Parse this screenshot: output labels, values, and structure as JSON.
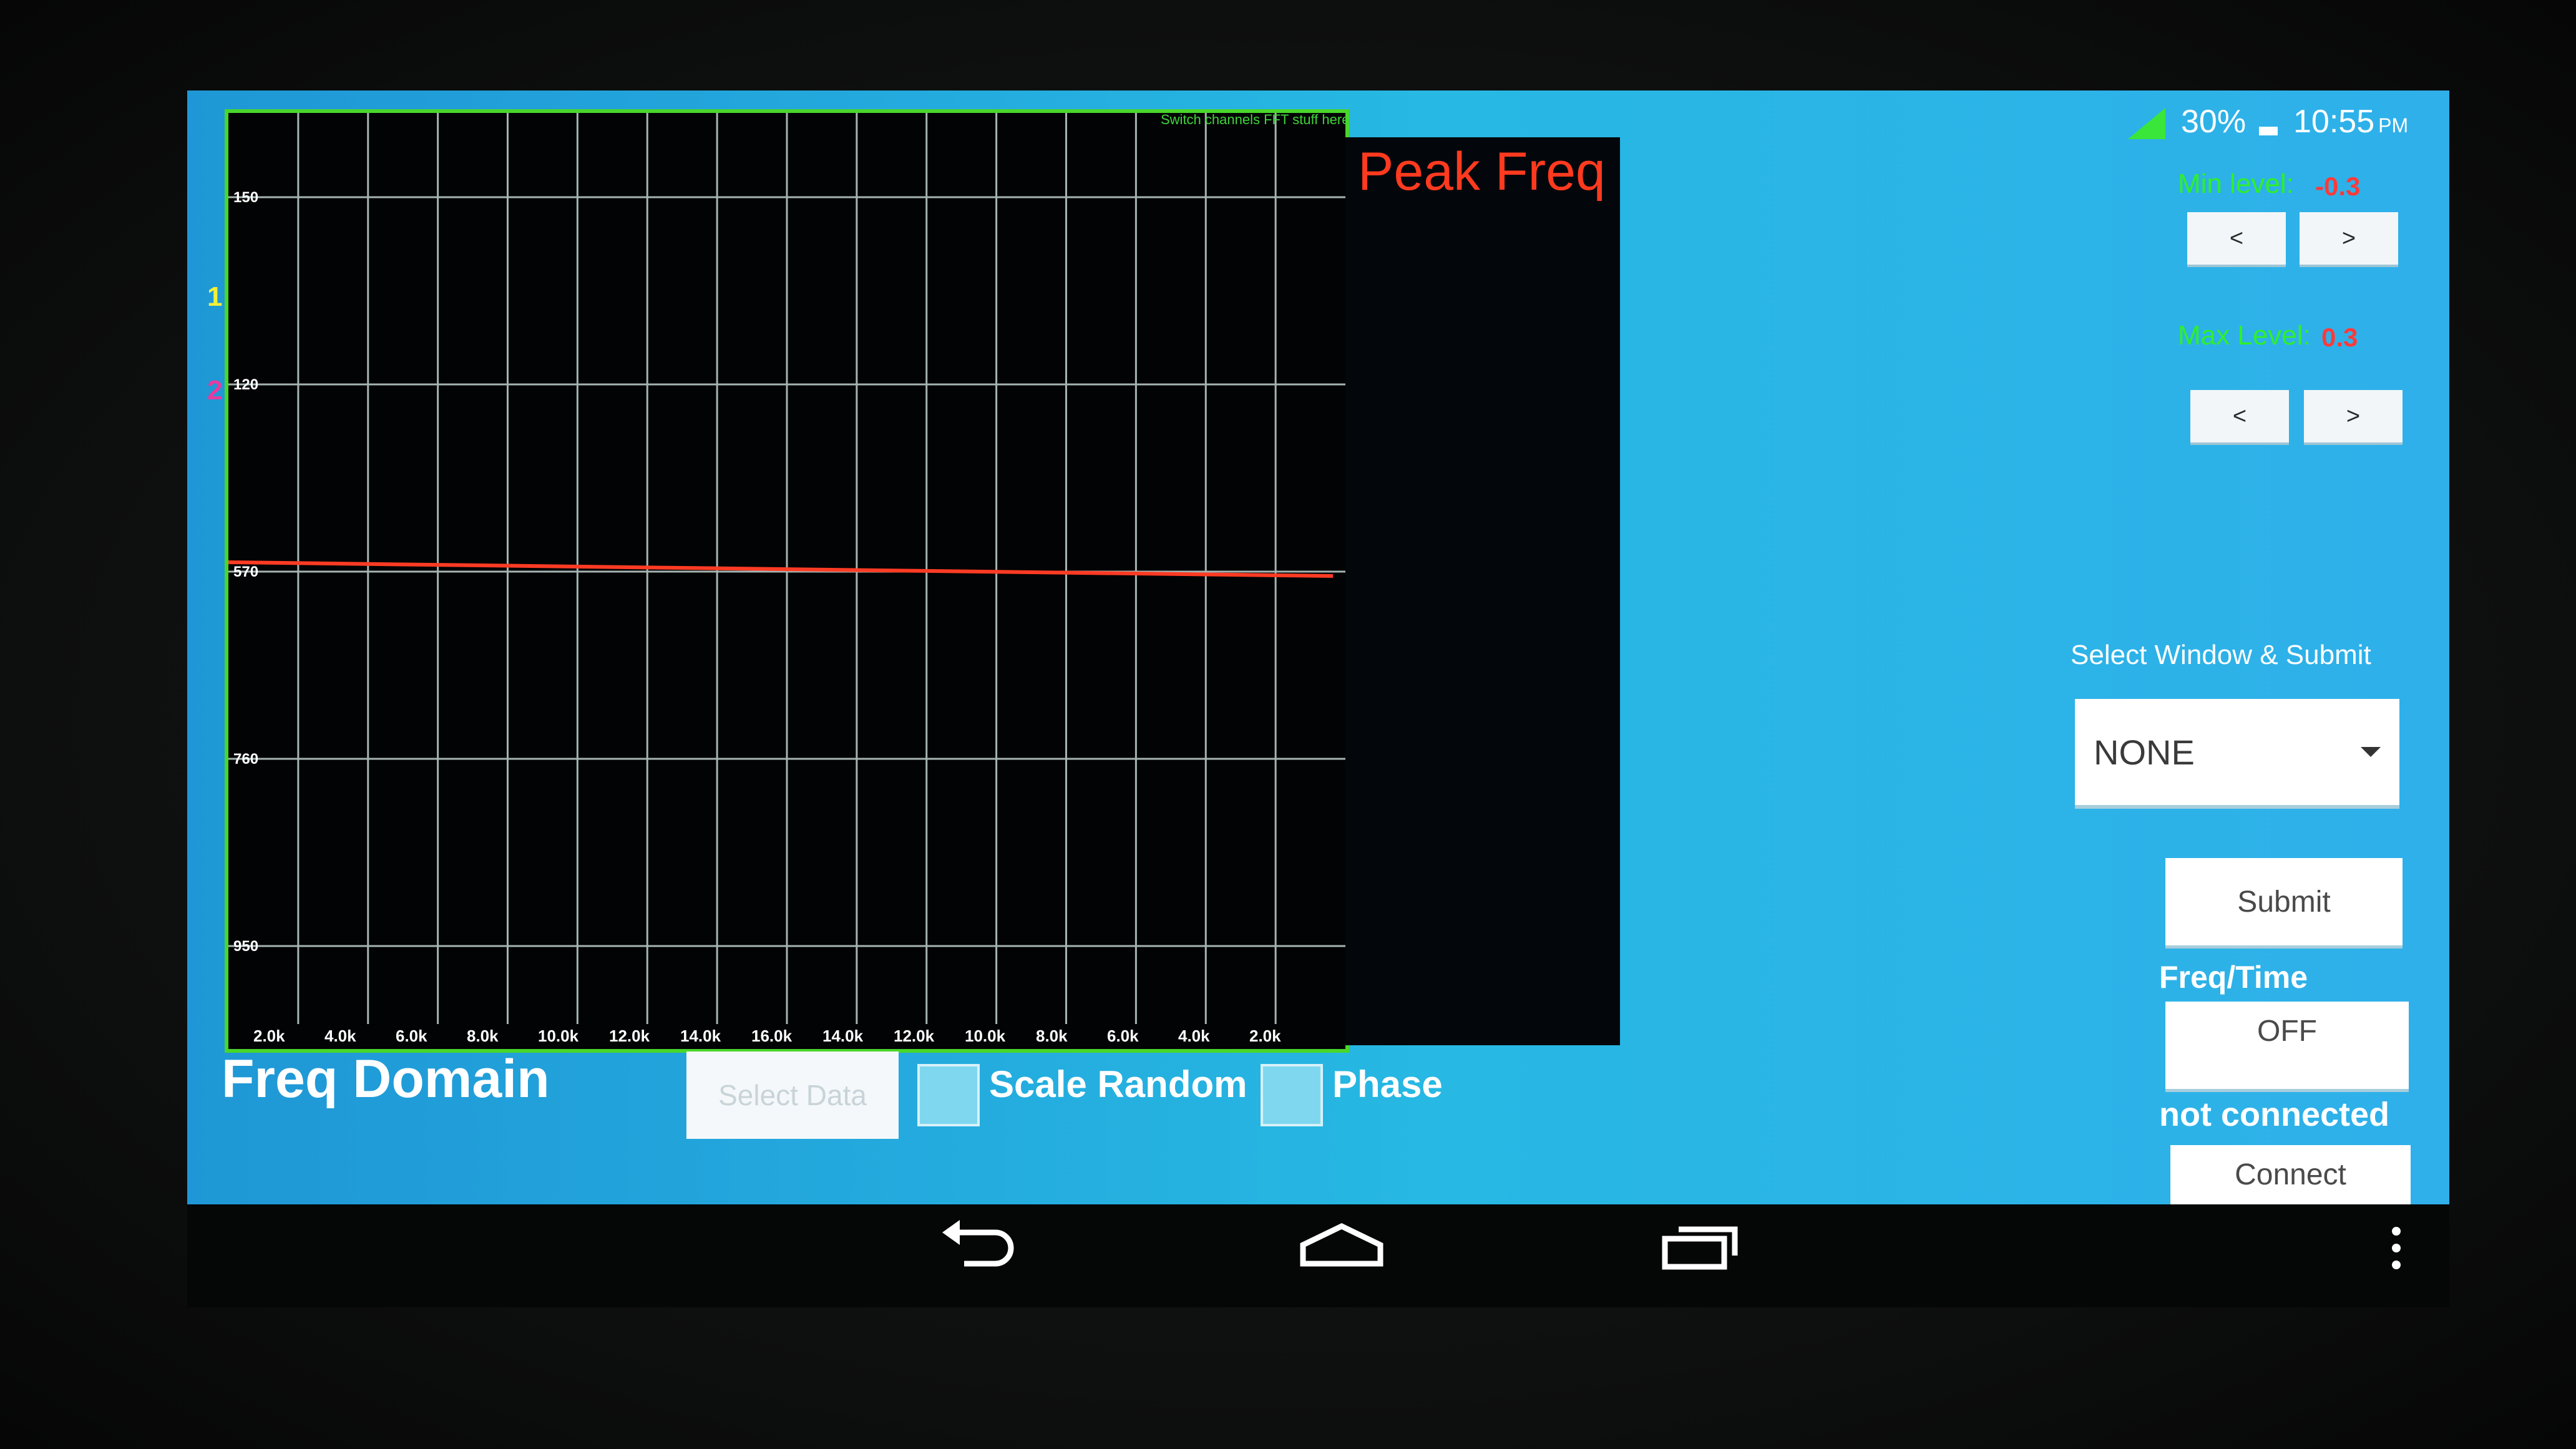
{
  "status_bar": {
    "battery": "30%",
    "time": "10:55",
    "ampm": "PM"
  },
  "graph": {
    "subtitle": "Switch channels FFT stuff here",
    "peak_label": "Peak Freq",
    "markers": [
      "1",
      "2"
    ],
    "y_ticks": [
      "150",
      "120",
      "570",
      "760",
      "950"
    ],
    "x_ticks": [
      "2.0k",
      "4.0k",
      "6.0k",
      "8.0k",
      "10.0k",
      "12.0k",
      "14.0k",
      "16.0k",
      "14.0k",
      "12.0k",
      "10.0k",
      "8.0k",
      "6.0k",
      "4.0k",
      "2.0k"
    ],
    "line_color": "#ff3b24",
    "grid_color": "#a5b4b2",
    "border_color": "#49d62b"
  },
  "bottom": {
    "title": "Freq Domain",
    "select_data": "Select Data",
    "scale_random": "Scale Random",
    "phase": "Phase"
  },
  "controls": {
    "min_label": "Min level:",
    "min_value": "-0.3",
    "max_label": "Max Level:",
    "max_value": "0.3",
    "dec": "<",
    "inc": ">",
    "window_label": "Select Window & Submit",
    "window_value": "NONE",
    "submit": "Submit",
    "freq_time_label": "Freq/Time",
    "toggle": "OFF",
    "status": "not connected",
    "connect": "Connect"
  },
  "nav": {
    "icons": [
      "back-icon",
      "home-icon",
      "recent-apps-icon",
      "overflow-menu-icon"
    ]
  }
}
